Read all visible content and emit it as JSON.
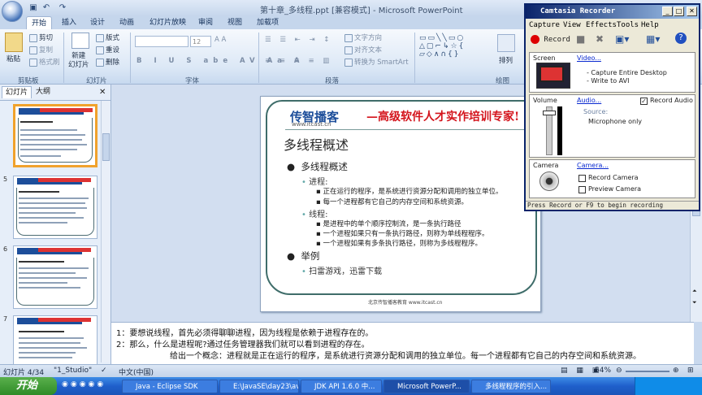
{
  "window": {
    "title": "第十章_多线程.ppt [兼容模式] - Microsoft PowerPoint"
  },
  "tabs": [
    "开始",
    "插入",
    "设计",
    "动画",
    "幻灯片放映",
    "审阅",
    "视图",
    "加载项"
  ],
  "ribbon": {
    "paste": "粘贴",
    "cut": "剪切",
    "copy": "复制",
    "format_painter": "格式刷",
    "new_slide": "新建\n幻灯片",
    "layout": "版式",
    "reset": "重设",
    "delete": "删除",
    "font_size": "12",
    "text_direction": "文字方向",
    "align_text": "对齐文本",
    "smartart": "转换为 SmartArt",
    "arrange": "排列",
    "groups": [
      "剪贴板",
      "幻灯片",
      "字体",
      "段落",
      "绘图"
    ]
  },
  "panel_tabs": [
    "幻灯片",
    "大纲"
  ],
  "thumbnails": [
    {
      "num": "",
      "title": "多线程概述",
      "selected": true
    },
    {
      "num": "5",
      "title": "Java程序中的进程",
      "selected": false
    },
    {
      "num": "6",
      "title": "多线程的实现方式",
      "selected": false
    },
    {
      "num": "7",
      "title": "如何获取执行的线程",
      "selected": false
    }
  ],
  "slide": {
    "logo": "传智播客",
    "logo_url": "www.itcast.cn",
    "slogan": "—高级软件人才实作培训专家!",
    "title": "多线程概述",
    "l1_a": "多线程概述",
    "l2_a": "进程:",
    "l3_a1": "正在运行的程序，是系统进行资源分配和调用的独立单位。",
    "l3_a2": "每一个进程都有它自己的内存空间和系统资源。",
    "l2_b": "线程:",
    "l3_b1": "是进程中的单个顺序控制流，是一条执行路径",
    "l3_b2": "一个进程如果只有一条执行路径，则称为单线程程序。",
    "l3_b3": "一个进程如果有多条执行路径，则称为多线程程序。",
    "l1_b": "举例",
    "l2_c": "扫雷游戏，迅雷下载",
    "footer": "北京传智播客教育 www.itcast.cn"
  },
  "notes": {
    "line1": "1：要想说线程，首先必须得聊聊进程，因为线程是依赖于进程存在的。",
    "line2": "2：那么，什么是进程呢?通过任务管理器我们就可以看到进程的存在。",
    "line3": "给出一个概念：进程就是正在运行的程序，是系统进行资源分配和调用的独立单位。每一个进程都有它自己的内存空间和系统资源。"
  },
  "status": {
    "slide_pos": "幻灯片 4/34",
    "theme": "\"1_Studio\"",
    "lang": "中文(中国)",
    "zoom": "54%"
  },
  "taskbar": {
    "start": "开始",
    "items": [
      "Java - Eclipse SDK",
      "E:\\JavaSE\\day23\\avi",
      "JDK API 1.6.0 中...",
      "Microsoft PowerP...",
      "多线程程序的引入..."
    ]
  },
  "camtasia": {
    "title": "Camtasia Recorder",
    "menu": [
      "Capture",
      "View",
      "Effects",
      "Tools",
      "Help"
    ],
    "record": "Record",
    "screen_label": "Screen",
    "video_link": "Video...",
    "video_info1": "- Capture Entire Desktop",
    "video_info2": "- Write to AVI",
    "volume_label": "Volume",
    "audio_link": "Audio...",
    "record_audio": "Record Audio",
    "source_label": "Source:",
    "source_value": "Microphone only",
    "camera_label": "Camera",
    "camera_link": "Camera...",
    "record_camera": "Record Camera",
    "preview_camera": "Preview Camera",
    "status": "Press Record or F9 to begin recording"
  }
}
